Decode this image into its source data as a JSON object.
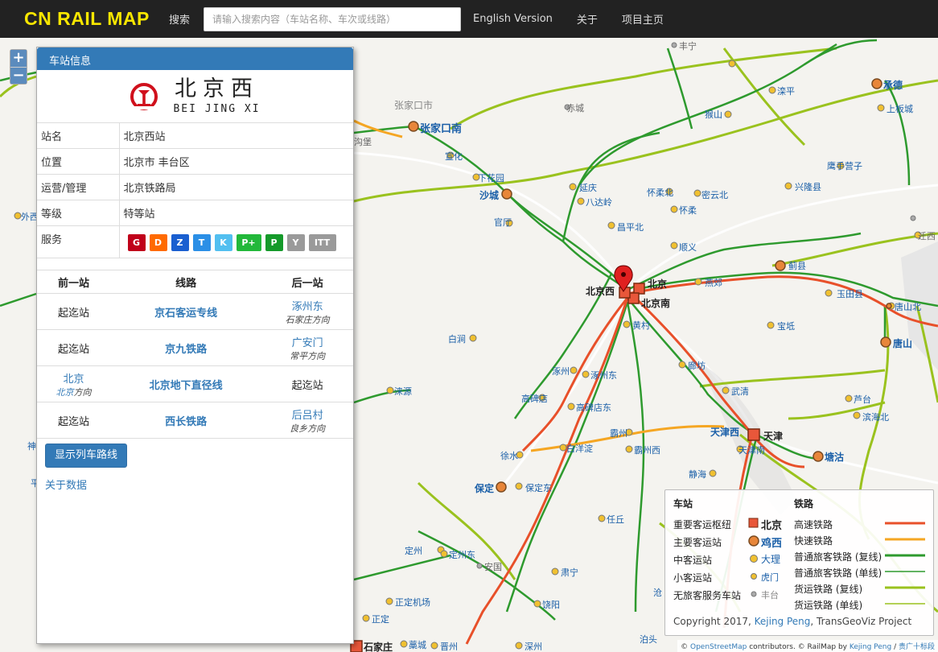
{
  "navbar": {
    "brand": "CN RAIL MAP",
    "search_label": "搜索",
    "search_placeholder": "请输入搜索内容（车站名称、车次或线路）",
    "english": "English Version",
    "about": "关于",
    "home": "项目主页"
  },
  "zoom": {
    "in": "+",
    "out": "−"
  },
  "panel": {
    "header": "车站信息",
    "name_cn": "北京西",
    "name_en": "BEI JING XI",
    "info": [
      {
        "key": "站名",
        "value": "北京西站"
      },
      {
        "key": "位置",
        "value": "北京市 丰台区"
      },
      {
        "key": "运营/管理",
        "value": "北京铁路局"
      },
      {
        "key": "等级",
        "value": "特等站"
      }
    ],
    "service_label": "服务",
    "services": [
      {
        "label": "G",
        "color": "#c0001a"
      },
      {
        "label": "D",
        "color": "#ff6a00"
      },
      {
        "label": "Z",
        "color": "#1a5fd0"
      },
      {
        "label": "T",
        "color": "#2b8fe6"
      },
      {
        "label": "K",
        "color": "#52bff0"
      },
      {
        "label": "P+",
        "color": "#22b83a"
      },
      {
        "label": "P",
        "color": "#159a2a"
      },
      {
        "label": "Y",
        "color": "#9a9a9a"
      },
      {
        "label": "ITT",
        "color": "#9a9a9a"
      }
    ],
    "routes_header": {
      "prev": "前一站",
      "line": "线路",
      "next": "后一站"
    },
    "routes": [
      {
        "prev": "起迄站",
        "prev_dir": "",
        "line": "京石客运专线",
        "next": "涿州东",
        "next_dir_city": "石家庄",
        "next_dir_suffix": "方向"
      },
      {
        "prev": "起迄站",
        "prev_dir": "",
        "line": "京九铁路",
        "next": "广安门",
        "next_dir_city": "常平",
        "next_dir_suffix": "方向"
      },
      {
        "prev": "北京",
        "prev_dir_city": "北京",
        "prev_dir_suffix": "方向",
        "line": "北京地下直径线",
        "next": "起迄站",
        "next_dir_city": "",
        "next_dir_suffix": ""
      },
      {
        "prev": "起迄站",
        "prev_dir": "",
        "line": "西长铁路",
        "next": "后吕村",
        "next_dir_city": "良乡",
        "next_dir_suffix": "方向"
      }
    ],
    "show_button": "显示列车路线",
    "about_data": "关于数据"
  },
  "legend": {
    "station_heading": "车站",
    "railway_heading": "铁路",
    "stations": [
      {
        "label": "重要客运枢纽",
        "sample": "北京"
      },
      {
        "label": "主要客运站",
        "sample": "鸡西"
      },
      {
        "label": "中客运站",
        "sample": "大理"
      },
      {
        "label": "小客运站",
        "sample": "虎门"
      },
      {
        "label": "无旅客服务车站",
        "sample": "丰台"
      }
    ],
    "railways": [
      {
        "label": "高速铁路",
        "color": "#e8502a"
      },
      {
        "label": "快速铁路",
        "color": "#f5a623"
      },
      {
        "label": "普通旅客铁路 (复线)",
        "color": "#2e9a2e"
      },
      {
        "label": "普通旅客铁路 (单线)",
        "color": "#2e9a2e"
      },
      {
        "label": "货运铁路 (复线)",
        "color": "#9ac21e"
      },
      {
        "label": "货运铁路 (单线)",
        "color": "#9ac21e"
      }
    ],
    "copyright_prefix": "Copyright 2017, ",
    "copyright_author": "Kejing Peng",
    "copyright_suffix": ", TransGeoViz Project"
  },
  "attribution": {
    "osm": "OpenStreetMap",
    "text1": " contributors. © RailMap by ",
    "author": "Kejing Peng",
    "sep": " / ",
    "gov": "贵广十标段"
  },
  "map_labels": [
    "张家口市",
    "张家口南",
    "赤城",
    "宣化",
    "下花园",
    "沙城",
    "延庆",
    "八达岭",
    "怀柔北",
    "密云北",
    "怀柔",
    "官厅",
    "昌平北",
    "顺义",
    "北京西",
    "北京",
    "北京南",
    "燕郊",
    "蓟县",
    "玉田县",
    "黄村",
    "宝坻",
    "唐山北",
    "唐山",
    "白涧",
    "涿州",
    "涿州东",
    "廊坊",
    "武清",
    "芦台",
    "涞源",
    "高碑店",
    "高碑店东",
    "滨海北",
    "霸州",
    "天津西",
    "天津",
    "天津南",
    "塘沽",
    "徐水",
    "白洋淀",
    "霸州西",
    "静海",
    "保定",
    "保定东",
    "任丘",
    "定州",
    "定州东",
    "安国",
    "肃宁",
    "正定机场",
    "饶阳",
    "正定",
    "藁城",
    "晋州",
    "深州",
    "石家庄",
    "承德",
    "上板城",
    "滦平",
    "猴山",
    "鹰手营子",
    "兴隆县",
    "丰宁",
    "外西",
    "迁西",
    "泊头",
    "沧",
    "沟堡",
    "神",
    "平"
  ]
}
